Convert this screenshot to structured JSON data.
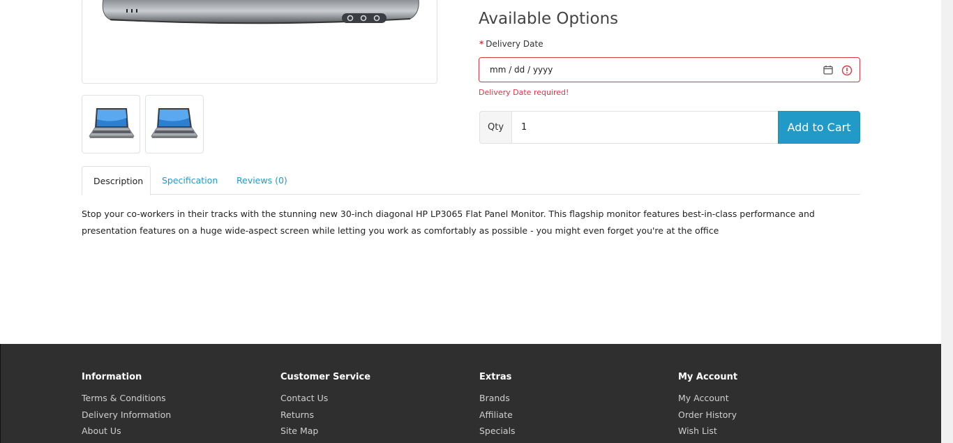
{
  "product": {
    "main_image_icon": "laptop-image",
    "thumbnails": [
      {
        "icon": "laptop-thumbnail"
      },
      {
        "icon": "laptop-thumbnail"
      }
    ]
  },
  "options": {
    "title": "Available Options",
    "delivery_date": {
      "required_marker": "*",
      "label": "Delivery Date",
      "placeholder": "mm / dd / yyyy",
      "error": "Delivery Date required!"
    }
  },
  "cart": {
    "qty_label": "Qty",
    "qty_value": "1",
    "add_label": "Add to Cart"
  },
  "tabs": [
    {
      "label": "Description",
      "active": true
    },
    {
      "label": "Specification",
      "active": false
    },
    {
      "label": "Reviews (0)",
      "active": false
    }
  ],
  "description": "Stop your co-workers in their tracks with the stunning new 30-inch diagonal HP LP3065 Flat Panel Monitor. This flagship monitor features best-in-class performance and presentation features on a huge wide-aspect screen while letting you work as comfortably as possible - you might even forget you're at the office",
  "footer": {
    "columns": [
      {
        "title": "Information",
        "links": [
          "Terms & Conditions",
          "Delivery Information",
          "About Us"
        ]
      },
      {
        "title": "Customer Service",
        "links": [
          "Contact Us",
          "Returns",
          "Site Map"
        ]
      },
      {
        "title": "Extras",
        "links": [
          "Brands",
          "Affiliate",
          "Specials"
        ]
      },
      {
        "title": "My Account",
        "links": [
          "My Account",
          "Order History",
          "Wish List"
        ]
      }
    ]
  },
  "colors": {
    "accent": "#229ac8",
    "error": "#dc3545",
    "footer_bg": "#2f2f2f"
  }
}
